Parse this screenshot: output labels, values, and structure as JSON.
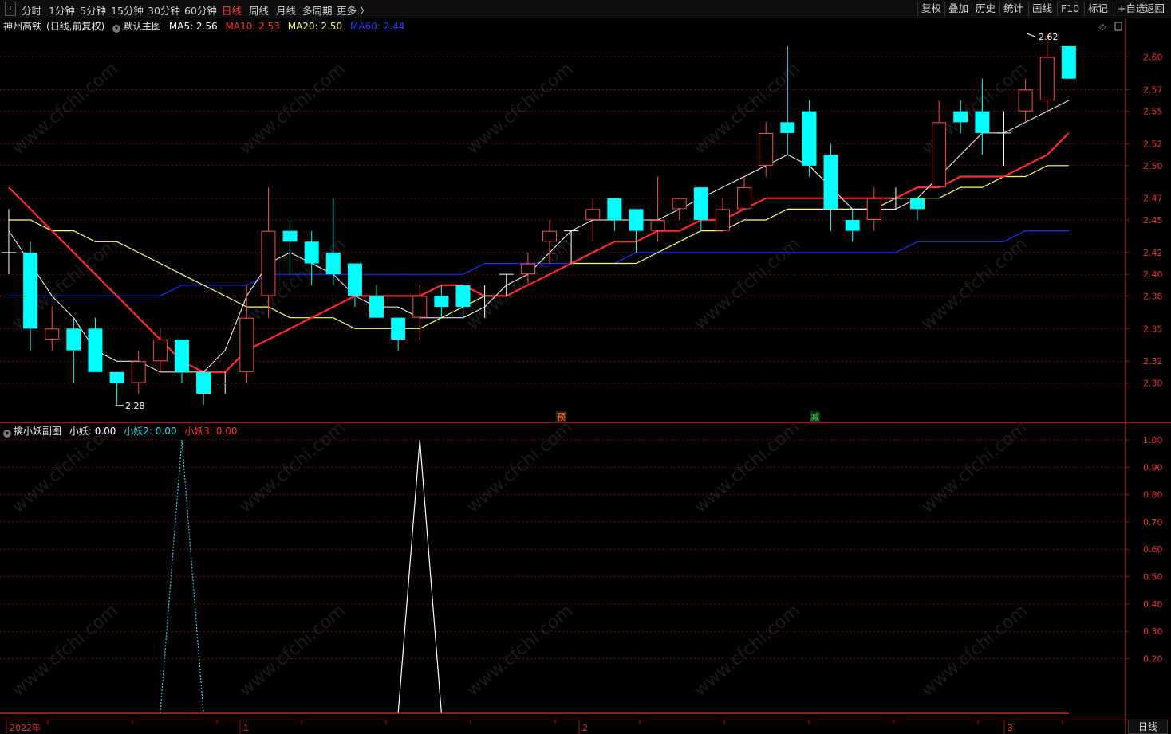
{
  "toolbar": {
    "left_items": [
      {
        "label": "分时",
        "active": false
      },
      {
        "label": "1分钟",
        "active": false
      },
      {
        "label": "5分钟",
        "active": false
      },
      {
        "label": "15分钟",
        "active": false
      },
      {
        "label": "30分钟",
        "active": false
      },
      {
        "label": "60分钟",
        "active": false
      },
      {
        "label": "日线",
        "active": true
      },
      {
        "label": "周线",
        "active": false
      },
      {
        "label": "月线",
        "active": false
      },
      {
        "label": "多周期",
        "active": false
      },
      {
        "label": "更多 〉",
        "active": false
      }
    ],
    "right_items": [
      "复权",
      "叠加",
      "历史",
      "统计",
      "画线",
      "F10",
      "标记",
      "+自选",
      "返回"
    ]
  },
  "main_legend": {
    "stock": "神州高铁",
    "period": "(日线,前复权)",
    "template": "默认主图",
    "ma5": "MA5: 2.56",
    "ma10": "MA10: 2.53",
    "ma20": "MA20: 2.50",
    "ma60": "MA60: 2.44"
  },
  "sub_legend": {
    "name": "擒小妖副图",
    "v1": "小妖: 0.00",
    "v2": "小妖2: 0.00",
    "v3": "小妖3: 0.00"
  },
  "colors": {
    "up": "#ff4a4a",
    "down": "#00ffff",
    "ma5": "#ffffff",
    "ma10": "#ff2b2b",
    "ma20": "#ffff66",
    "ma60": "#2030ff",
    "grid": "#a01010",
    "axis_text": "#e33333"
  },
  "price_axis": {
    "ticks": [
      "2.60",
      "2.57",
      "2.55",
      "2.52",
      "2.50",
      "2.47",
      "2.45",
      "2.42",
      "2.40",
      "2.38",
      "2.35",
      "2.32",
      "2.30"
    ]
  },
  "indicator_axis": {
    "ticks": [
      "1.00",
      "0.90",
      "0.80",
      "0.70",
      "0.60",
      "0.50",
      "0.40",
      "0.30",
      "0.20"
    ]
  },
  "markers": {
    "high": "2.62",
    "low": "2.28",
    "signal_yu": "预",
    "signal_jian": "减"
  },
  "date_axis": {
    "labels": [
      "2022年",
      "1",
      "2",
      "3"
    ]
  },
  "watermark": "www.cfchi.com",
  "period_tag": "日线",
  "chart_data": {
    "type": "candlestick",
    "price_range": [
      2.25,
      2.64
    ],
    "candles": [
      {
        "o": 2.42,
        "h": 2.46,
        "l": 2.4,
        "c": 2.42
      },
      {
        "o": 2.42,
        "h": 2.43,
        "l": 2.33,
        "c": 2.35
      },
      {
        "o": 2.34,
        "h": 2.37,
        "l": 2.33,
        "c": 2.35
      },
      {
        "o": 2.35,
        "h": 2.36,
        "l": 2.3,
        "c": 2.33
      },
      {
        "o": 2.35,
        "h": 2.36,
        "l": 2.31,
        "c": 2.31
      },
      {
        "o": 2.31,
        "h": 2.31,
        "l": 2.28,
        "c": 2.3
      },
      {
        "o": 2.3,
        "h": 2.33,
        "l": 2.29,
        "c": 2.32
      },
      {
        "o": 2.32,
        "h": 2.35,
        "l": 2.31,
        "c": 2.34
      },
      {
        "o": 2.34,
        "h": 2.34,
        "l": 2.3,
        "c": 2.31
      },
      {
        "o": 2.31,
        "h": 2.31,
        "l": 2.28,
        "c": 2.29
      },
      {
        "o": 2.3,
        "h": 2.31,
        "l": 2.29,
        "c": 2.3
      },
      {
        "o": 2.31,
        "h": 2.39,
        "l": 2.3,
        "c": 2.36
      },
      {
        "o": 2.38,
        "h": 2.48,
        "l": 2.36,
        "c": 2.44
      },
      {
        "o": 2.44,
        "h": 2.45,
        "l": 2.4,
        "c": 2.43
      },
      {
        "o": 2.43,
        "h": 2.44,
        "l": 2.39,
        "c": 2.41
      },
      {
        "o": 2.42,
        "h": 2.47,
        "l": 2.39,
        "c": 2.4
      },
      {
        "o": 2.41,
        "h": 2.41,
        "l": 2.37,
        "c": 2.38
      },
      {
        "o": 2.38,
        "h": 2.39,
        "l": 2.36,
        "c": 2.36
      },
      {
        "o": 2.36,
        "h": 2.36,
        "l": 2.33,
        "c": 2.34
      },
      {
        "o": 2.36,
        "h": 2.39,
        "l": 2.34,
        "c": 2.38
      },
      {
        "o": 2.38,
        "h": 2.39,
        "l": 2.36,
        "c": 2.37
      },
      {
        "o": 2.39,
        "h": 2.39,
        "l": 2.36,
        "c": 2.37
      },
      {
        "o": 2.38,
        "h": 2.39,
        "l": 2.36,
        "c": 2.38
      },
      {
        "o": 2.4,
        "h": 2.4,
        "l": 2.38,
        "c": 2.4
      },
      {
        "o": 2.4,
        "h": 2.42,
        "l": 2.39,
        "c": 2.41
      },
      {
        "o": 2.43,
        "h": 2.45,
        "l": 2.41,
        "c": 2.44
      },
      {
        "o": 2.44,
        "h": 2.44,
        "l": 2.41,
        "c": 2.44
      },
      {
        "o": 2.45,
        "h": 2.47,
        "l": 2.43,
        "c": 2.46
      },
      {
        "o": 2.47,
        "h": 2.47,
        "l": 2.44,
        "c": 2.45
      },
      {
        "o": 2.46,
        "h": 2.46,
        "l": 2.42,
        "c": 2.44
      },
      {
        "o": 2.44,
        "h": 2.49,
        "l": 2.43,
        "c": 2.45
      },
      {
        "o": 2.46,
        "h": 2.47,
        "l": 2.45,
        "c": 2.47
      },
      {
        "o": 2.48,
        "h": 2.48,
        "l": 2.44,
        "c": 2.45
      },
      {
        "o": 2.44,
        "h": 2.47,
        "l": 2.44,
        "c": 2.46
      },
      {
        "o": 2.46,
        "h": 2.49,
        "l": 2.46,
        "c": 2.48
      },
      {
        "o": 2.5,
        "h": 2.54,
        "l": 2.49,
        "c": 2.53
      },
      {
        "o": 2.54,
        "h": 2.61,
        "l": 2.51,
        "c": 2.53
      },
      {
        "o": 2.55,
        "h": 2.56,
        "l": 2.49,
        "c": 2.5
      },
      {
        "o": 2.51,
        "h": 2.52,
        "l": 2.44,
        "c": 2.46
      },
      {
        "o": 2.45,
        "h": 2.46,
        "l": 2.43,
        "c": 2.44
      },
      {
        "o": 2.45,
        "h": 2.48,
        "l": 2.44,
        "c": 2.47
      },
      {
        "o": 2.47,
        "h": 2.48,
        "l": 2.46,
        "c": 2.47
      },
      {
        "o": 2.47,
        "h": 2.47,
        "l": 2.45,
        "c": 2.46
      },
      {
        "o": 2.48,
        "h": 2.56,
        "l": 2.48,
        "c": 2.54
      },
      {
        "o": 2.55,
        "h": 2.56,
        "l": 2.53,
        "c": 2.54
      },
      {
        "o": 2.55,
        "h": 2.58,
        "l": 2.51,
        "c": 2.53
      },
      {
        "o": 2.53,
        "h": 2.55,
        "l": 2.5,
        "c": 2.53
      },
      {
        "o": 2.55,
        "h": 2.58,
        "l": 2.54,
        "c": 2.57
      },
      {
        "o": 2.56,
        "h": 2.62,
        "l": 2.55,
        "c": 2.6
      },
      {
        "o": 2.61,
        "h": 2.61,
        "l": 2.58,
        "c": 2.58
      }
    ],
    "ma": {
      "MA5": [
        2.44,
        2.41,
        2.38,
        2.36,
        2.33,
        2.32,
        2.32,
        2.31,
        2.31,
        2.31,
        2.33,
        2.38,
        2.41,
        2.42,
        2.41,
        2.4,
        2.38,
        2.37,
        2.37,
        2.36,
        2.36,
        2.36,
        2.37,
        2.39,
        2.4,
        2.42,
        2.44,
        2.45,
        2.45,
        2.45,
        2.45,
        2.46,
        2.47,
        2.48,
        2.49,
        2.5,
        2.51,
        2.5,
        2.48,
        2.46,
        2.46,
        2.46,
        2.47,
        2.49,
        2.51,
        2.53,
        2.53,
        2.54,
        2.55,
        2.56
      ],
      "MA10": [
        2.48,
        2.46,
        2.44,
        2.42,
        2.4,
        2.38,
        2.36,
        2.34,
        2.32,
        2.31,
        2.31,
        2.33,
        2.34,
        2.35,
        2.36,
        2.37,
        2.38,
        2.38,
        2.38,
        2.38,
        2.39,
        2.39,
        2.38,
        2.38,
        2.39,
        2.4,
        2.41,
        2.42,
        2.43,
        2.43,
        2.44,
        2.44,
        2.45,
        2.45,
        2.46,
        2.47,
        2.47,
        2.47,
        2.47,
        2.47,
        2.47,
        2.47,
        2.48,
        2.48,
        2.49,
        2.49,
        2.49,
        2.5,
        2.51,
        2.53
      ],
      "MA20": [
        2.45,
        2.45,
        2.44,
        2.44,
        2.43,
        2.43,
        2.42,
        2.41,
        2.4,
        2.39,
        2.38,
        2.37,
        2.37,
        2.36,
        2.36,
        2.36,
        2.35,
        2.35,
        2.35,
        2.35,
        2.36,
        2.37,
        2.38,
        2.38,
        2.39,
        2.4,
        2.41,
        2.41,
        2.41,
        2.41,
        2.42,
        2.43,
        2.44,
        2.44,
        2.45,
        2.45,
        2.46,
        2.46,
        2.46,
        2.46,
        2.46,
        2.47,
        2.47,
        2.47,
        2.48,
        2.48,
        2.49,
        2.49,
        2.5,
        2.5
      ],
      "MA60": [
        2.38,
        2.38,
        2.38,
        2.38,
        2.38,
        2.38,
        2.38,
        2.38,
        2.39,
        2.39,
        2.39,
        2.39,
        2.4,
        2.4,
        2.4,
        2.4,
        2.4,
        2.4,
        2.4,
        2.4,
        2.4,
        2.4,
        2.41,
        2.41,
        2.41,
        2.41,
        2.41,
        2.41,
        2.41,
        2.42,
        2.42,
        2.42,
        2.42,
        2.42,
        2.42,
        2.42,
        2.42,
        2.42,
        2.42,
        2.42,
        2.42,
        2.42,
        2.43,
        2.43,
        2.43,
        2.43,
        2.43,
        2.44,
        2.44,
        2.44
      ]
    },
    "indicator": {
      "xiaoyao": [
        0,
        0,
        0,
        0,
        0,
        0,
        0,
        0,
        0,
        0,
        0,
        0,
        0,
        0,
        0,
        0,
        0,
        0,
        0,
        1,
        0,
        0,
        0,
        0,
        0,
        0,
        0,
        0,
        0,
        0,
        0,
        0,
        0,
        0,
        0,
        0,
        0,
        0,
        0,
        0,
        0,
        0,
        0,
        0,
        0,
        0,
        0,
        0,
        0,
        0
      ],
      "xiaoyao2": [
        0,
        0,
        0,
        0,
        0,
        0,
        0,
        0,
        1,
        0,
        0,
        0,
        0,
        0,
        0,
        0,
        0,
        0,
        0,
        0,
        0,
        0,
        0,
        0,
        0,
        0,
        0,
        0,
        0,
        0,
        0,
        0,
        0,
        0,
        0,
        0,
        0,
        0,
        0,
        0,
        0,
        0,
        0,
        0,
        0,
        0,
        0,
        0,
        0,
        0
      ],
      "xiaoyao3": [
        0,
        0,
        0,
        0,
        0,
        0,
        0,
        0,
        0,
        0,
        0,
        0,
        0,
        0,
        0,
        0,
        0,
        0,
        0,
        0,
        0,
        0,
        0,
        0,
        0,
        0,
        0,
        0,
        0,
        0,
        0,
        0,
        0,
        0,
        0,
        0,
        0,
        0,
        0,
        0,
        0,
        0,
        0,
        0,
        0,
        0,
        0,
        0,
        0,
        0
      ],
      "range": [
        0,
        1.05
      ]
    }
  }
}
